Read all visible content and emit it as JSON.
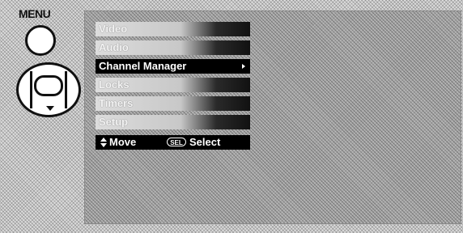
{
  "remote": {
    "menu_label": "MENU"
  },
  "osd_menu": {
    "items": [
      {
        "label": "Video",
        "selected": false
      },
      {
        "label": "Audio",
        "selected": false
      },
      {
        "label": "Channel Manager",
        "selected": true
      },
      {
        "label": "Locks",
        "selected": false
      },
      {
        "label": "Timers",
        "selected": false
      },
      {
        "label": "Setup",
        "selected": false
      }
    ],
    "help": {
      "move_label": "Move",
      "sel_key": "SEL",
      "select_label": "Select"
    }
  },
  "icons": [
    "menu-button-icon",
    "dpad-icon",
    "up-down-arrow-icon",
    "sel-key-icon",
    "right-arrow-icon"
  ]
}
